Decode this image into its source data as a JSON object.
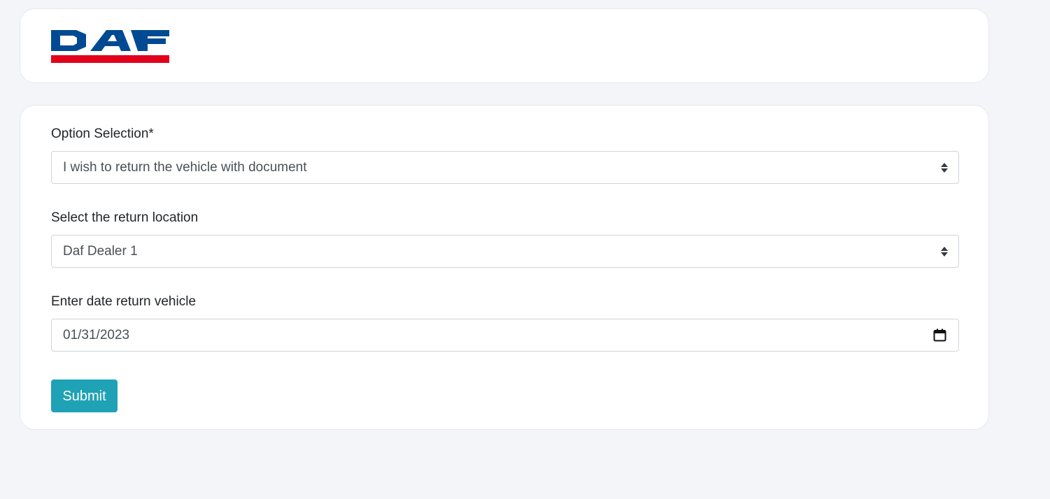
{
  "brand": {
    "logo_text": "DAF",
    "colors": {
      "blue": "#004a93",
      "red": "#e2001a"
    }
  },
  "form": {
    "option_selection": {
      "label": "Option Selection*",
      "selected": "I wish to return the vehicle with document",
      "icon": "sort-caret-icon"
    },
    "return_location": {
      "label": "Select the return location",
      "selected": "Daf Dealer 1",
      "icon": "sort-caret-icon"
    },
    "return_date": {
      "label": "Enter date return vehicle",
      "value": "01/31/2023",
      "icon": "calendar-icon"
    },
    "submit_label": "Submit"
  },
  "colors": {
    "page_background": "#f4f5f8",
    "card_background": "#ffffff",
    "accent": "#1fa2b5"
  }
}
